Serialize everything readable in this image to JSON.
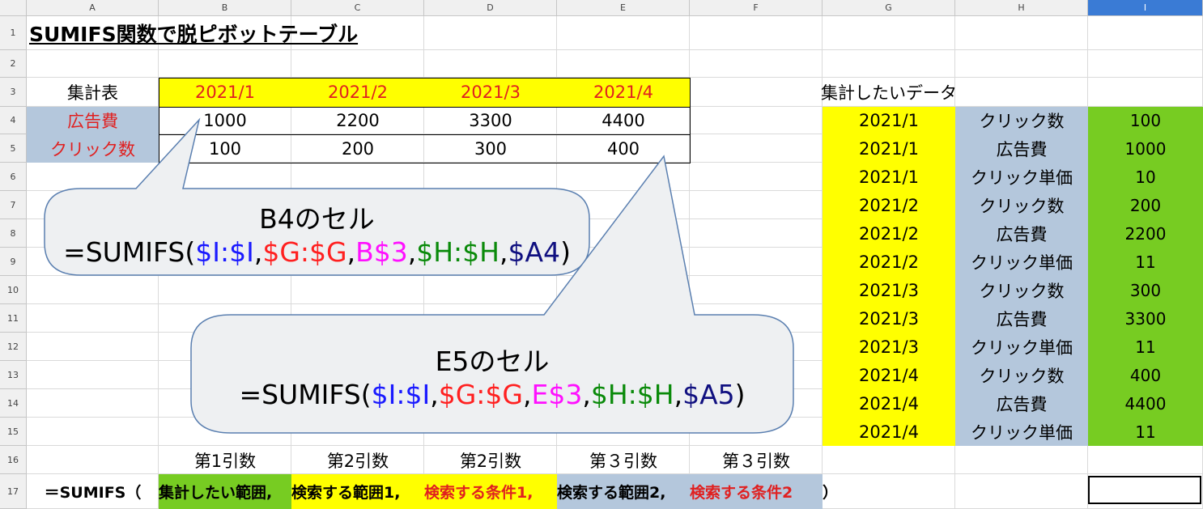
{
  "columns": [
    "A",
    "B",
    "C",
    "D",
    "E",
    "F",
    "G",
    "H",
    "I"
  ],
  "rows": [
    "1",
    "2",
    "3",
    "4",
    "5",
    "6",
    "7",
    "8",
    "9",
    "10",
    "11",
    "12",
    "13",
    "14",
    "15",
    "16",
    "17"
  ],
  "title": "SUMIFS関数で脱ピボットテーブル",
  "summary_table": {
    "header_label": "集計表",
    "months": [
      "2021/1",
      "2021/2",
      "2021/3",
      "2021/4"
    ],
    "rows": [
      {
        "label": "広告費",
        "values": [
          "1000",
          "2200",
          "3300",
          "4400"
        ]
      },
      {
        "label": "クリック数",
        "values": [
          "100",
          "200",
          "300",
          "400"
        ]
      }
    ]
  },
  "data_table": {
    "heading": "集計したいデータ",
    "rows": [
      [
        "2021/1",
        "クリック数",
        "100"
      ],
      [
        "2021/1",
        "広告費",
        "1000"
      ],
      [
        "2021/1",
        "クリック単価",
        "10"
      ],
      [
        "2021/2",
        "クリック数",
        "200"
      ],
      [
        "2021/2",
        "広告費",
        "2200"
      ],
      [
        "2021/2",
        "クリック単価",
        "11"
      ],
      [
        "2021/3",
        "クリック数",
        "300"
      ],
      [
        "2021/3",
        "広告費",
        "3300"
      ],
      [
        "2021/3",
        "クリック単価",
        "11"
      ],
      [
        "2021/4",
        "クリック数",
        "400"
      ],
      [
        "2021/4",
        "広告費",
        "4400"
      ],
      [
        "2021/4",
        "クリック単価",
        "11"
      ]
    ]
  },
  "callout1": {
    "title": "B4のセル",
    "parts": [
      "=SUMIFS(",
      "$I:$I",
      ",",
      "$G:$G",
      ",",
      "B$3",
      ",",
      "$H:$H",
      ",",
      "$A4",
      ")"
    ]
  },
  "callout2": {
    "title": "E5のセル",
    "parts": [
      "=SUMIFS(",
      "$I:$I",
      ",",
      "$G:$G",
      ",",
      "E$3",
      ",",
      "$H:$H",
      ",",
      "$A5",
      ")"
    ]
  },
  "arg_labels": [
    "第1引数",
    "第2引数",
    "第2引数",
    "第３引数",
    "第３引数"
  ],
  "syntax": {
    "prefix": "＝SUMIFS（",
    "arg1": "集計したい範囲,",
    "arg2": "検索する範囲1,",
    "arg3": "検索する条件1,",
    "arg4": "検索する範囲2,",
    "arg5": "検索する条件2",
    "suffix": "）"
  },
  "colors": {
    "yellow": "#ffff00",
    "blue_gray": "#b4c7dc",
    "green": "#77cc22",
    "red_text": "#e02020"
  }
}
